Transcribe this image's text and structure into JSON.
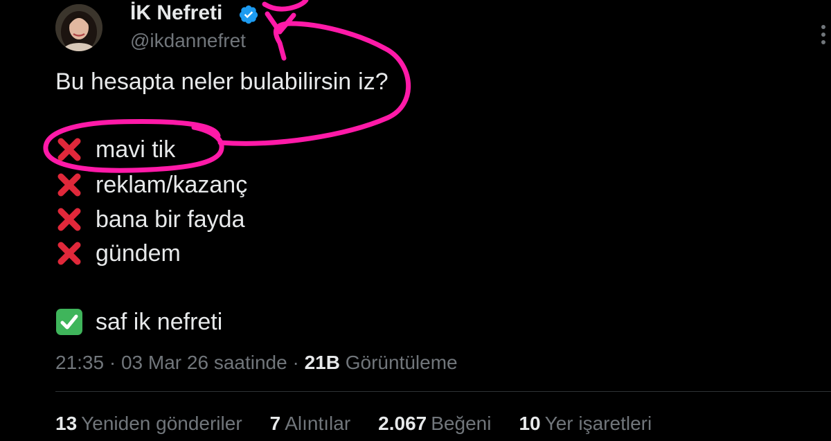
{
  "tweet": {
    "author": {
      "display_name": "İK Nefreti",
      "handle": "@ikdannefret",
      "verified": true,
      "avatar_icon": "profile-photo"
    },
    "text_lines": {
      "intro_part1": "Bu hesapta neler bulabilirsin",
      "intro_part2": "iz?",
      "items": [
        {
          "emoji": "cross-mark-icon",
          "text": "mavi tik"
        },
        {
          "emoji": "cross-mark-icon",
          "text": "reklam/kazanç"
        },
        {
          "emoji": "cross-mark-icon",
          "text": "bana bir fayda"
        },
        {
          "emoji": "cross-mark-icon",
          "text": "gündem"
        }
      ],
      "final_item": {
        "emoji": "check-mark-button-icon",
        "text": "saf ik nefreti"
      }
    },
    "meta": {
      "time": "21:35",
      "date": "03 Mar 26 saatinde",
      "views_count": "21B",
      "views_label": "Görüntüleme"
    },
    "stats": [
      {
        "count": "13",
        "label": "Yeniden gönderiler"
      },
      {
        "count": "7",
        "label": "Alıntılar"
      },
      {
        "count": "2.067",
        "label": "Beğeni"
      },
      {
        "count": "10",
        "label": "Yer işaretleri"
      }
    ]
  },
  "colors": {
    "background": "#000000",
    "text_primary": "#e7e9ea",
    "text_secondary": "#71767b",
    "verified_blue": "#1d9bf0",
    "cross_red": "#e0283a",
    "check_green": "#3fb55b",
    "annotation_pink": "#ff1aa8",
    "divider": "#2f3336"
  }
}
